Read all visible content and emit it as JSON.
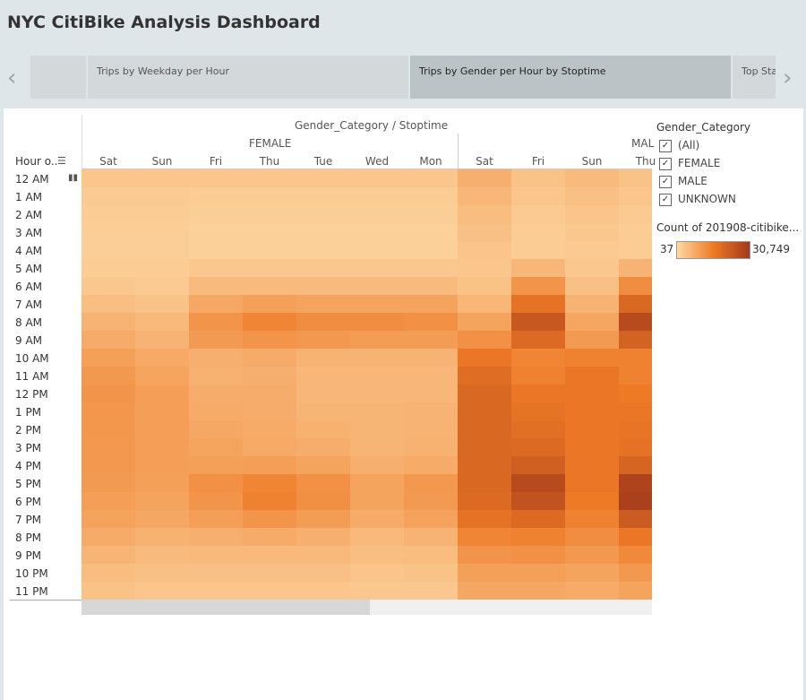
{
  "dashboard": {
    "title": "NYC CitiBike Analysis Dashboard"
  },
  "tabs": [
    {
      "label": ""
    },
    {
      "label": "Trips by Weekday per Hour"
    },
    {
      "label": "Trips by Gender  per Hour by Stoptime"
    },
    {
      "label": "Top Sta"
    }
  ],
  "nav": {
    "prev_icon": "chevron-left-icon",
    "next_icon": "chevron-right-icon"
  },
  "header": {
    "column_group_title": "Gender_Category / Stoptime",
    "row_header": "Hour o..",
    "sort_icon": "sort-icon",
    "group_female": "FEMALE",
    "group_male": "MAL"
  },
  "days": {
    "female": [
      "Sat",
      "Sun",
      "Fri",
      "Thu",
      "Tue",
      "Wed",
      "Mon"
    ],
    "male": [
      "Sat",
      "Fri",
      "Sun",
      "Thu"
    ]
  },
  "hours": [
    "12 AM",
    "1 AM",
    "2 AM",
    "3 AM",
    "4 AM",
    "5 AM",
    "6 AM",
    "7 AM",
    "8 AM",
    "9 AM",
    "10 AM",
    "11 AM",
    "12 PM",
    "1 PM",
    "2 PM",
    "3 PM",
    "4 PM",
    "5 PM",
    "6 PM",
    "7 PM",
    "8 PM",
    "9 PM",
    "10 PM",
    "11 PM"
  ],
  "filter": {
    "title": "Gender_Category",
    "options": [
      {
        "label": "(All)",
        "checked": true
      },
      {
        "label": "FEMALE",
        "checked": true
      },
      {
        "label": "MALE",
        "checked": true
      },
      {
        "label": "UNKNOWN",
        "checked": true
      }
    ]
  },
  "color_legend": {
    "title": "Count of 201908-citibike...",
    "min": "37",
    "max": "30,749",
    "min_color": "#fdd9a6",
    "mid_color": "#ee7a26",
    "max_color": "#a2391b"
  },
  "heat_levels": {
    "female": [
      [
        0.1,
        0.1,
        0.1,
        0.1,
        0.1,
        0.1,
        0.1
      ],
      [
        0.08,
        0.08,
        0.07,
        0.07,
        0.07,
        0.07,
        0.07
      ],
      [
        0.07,
        0.07,
        0.06,
        0.06,
        0.06,
        0.06,
        0.06
      ],
      [
        0.06,
        0.06,
        0.05,
        0.05,
        0.05,
        0.05,
        0.05
      ],
      [
        0.06,
        0.06,
        0.05,
        0.05,
        0.05,
        0.05,
        0.05
      ],
      [
        0.07,
        0.07,
        0.09,
        0.09,
        0.09,
        0.09,
        0.09
      ],
      [
        0.09,
        0.08,
        0.16,
        0.16,
        0.16,
        0.16,
        0.16
      ],
      [
        0.14,
        0.12,
        0.26,
        0.3,
        0.28,
        0.28,
        0.28
      ],
      [
        0.2,
        0.17,
        0.36,
        0.44,
        0.4,
        0.4,
        0.38
      ],
      [
        0.24,
        0.2,
        0.33,
        0.36,
        0.34,
        0.32,
        0.32
      ],
      [
        0.3,
        0.25,
        0.22,
        0.24,
        0.2,
        0.2,
        0.2
      ],
      [
        0.34,
        0.28,
        0.21,
        0.22,
        0.18,
        0.18,
        0.18
      ],
      [
        0.36,
        0.31,
        0.23,
        0.23,
        0.18,
        0.18,
        0.18
      ],
      [
        0.35,
        0.31,
        0.24,
        0.23,
        0.19,
        0.19,
        0.2
      ],
      [
        0.35,
        0.31,
        0.26,
        0.24,
        0.21,
        0.19,
        0.2
      ],
      [
        0.34,
        0.31,
        0.28,
        0.25,
        0.23,
        0.19,
        0.21
      ],
      [
        0.34,
        0.31,
        0.3,
        0.31,
        0.28,
        0.22,
        0.24
      ],
      [
        0.33,
        0.3,
        0.38,
        0.44,
        0.38,
        0.28,
        0.34
      ],
      [
        0.31,
        0.28,
        0.36,
        0.46,
        0.39,
        0.28,
        0.33
      ],
      [
        0.29,
        0.26,
        0.31,
        0.36,
        0.32,
        0.24,
        0.29
      ],
      [
        0.24,
        0.21,
        0.22,
        0.24,
        0.22,
        0.17,
        0.2
      ],
      [
        0.19,
        0.16,
        0.17,
        0.17,
        0.17,
        0.14,
        0.15
      ],
      [
        0.15,
        0.13,
        0.13,
        0.13,
        0.13,
        0.11,
        0.12
      ],
      [
        0.12,
        0.1,
        0.1,
        0.1,
        0.1,
        0.09,
        0.09
      ]
    ],
    "male": [
      [
        0.22,
        0.12,
        0.16,
        0.12
      ],
      [
        0.18,
        0.1,
        0.13,
        0.1
      ],
      [
        0.15,
        0.08,
        0.11,
        0.08
      ],
      [
        0.13,
        0.07,
        0.09,
        0.07
      ],
      [
        0.11,
        0.07,
        0.08,
        0.07
      ],
      [
        0.1,
        0.18,
        0.09,
        0.2
      ],
      [
        0.12,
        0.36,
        0.13,
        0.4
      ],
      [
        0.18,
        0.56,
        0.2,
        0.64
      ],
      [
        0.28,
        0.76,
        0.27,
        0.86
      ],
      [
        0.38,
        0.62,
        0.33,
        0.68
      ],
      [
        0.52,
        0.44,
        0.46,
        0.46
      ],
      [
        0.6,
        0.46,
        0.52,
        0.46
      ],
      [
        0.64,
        0.52,
        0.52,
        0.5
      ],
      [
        0.64,
        0.55,
        0.52,
        0.52
      ],
      [
        0.64,
        0.58,
        0.52,
        0.54
      ],
      [
        0.64,
        0.62,
        0.52,
        0.56
      ],
      [
        0.64,
        0.7,
        0.52,
        0.66
      ],
      [
        0.64,
        0.86,
        0.52,
        0.92
      ],
      [
        0.62,
        0.8,
        0.5,
        0.94
      ],
      [
        0.56,
        0.62,
        0.46,
        0.74
      ],
      [
        0.44,
        0.46,
        0.4,
        0.52
      ],
      [
        0.36,
        0.38,
        0.34,
        0.42
      ],
      [
        0.3,
        0.3,
        0.28,
        0.34
      ],
      [
        0.26,
        0.26,
        0.24,
        0.28
      ]
    ]
  }
}
